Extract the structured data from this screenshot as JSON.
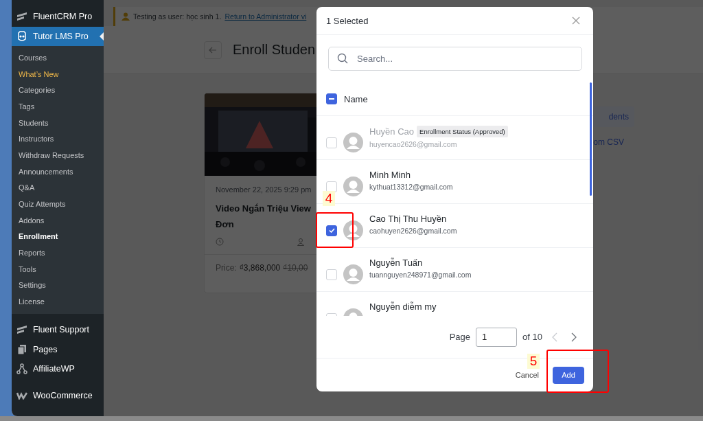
{
  "sidebar": {
    "items": [
      {
        "label": "FluentCRM Pro",
        "selected": false
      },
      {
        "label": "Tutor LMS Pro",
        "selected": true,
        "children": [
          {
            "label": "Courses",
            "selected": false,
            "accent": false
          },
          {
            "label": "What’s New",
            "selected": false,
            "accent": true
          },
          {
            "label": "Categories",
            "selected": false,
            "accent": false
          },
          {
            "label": "Tags",
            "selected": false,
            "accent": false
          },
          {
            "label": "Students",
            "selected": false,
            "accent": false
          },
          {
            "label": "Instructors",
            "selected": false,
            "accent": false
          },
          {
            "label": "Withdraw Requests",
            "selected": false,
            "accent": false
          },
          {
            "label": "Announcements",
            "selected": false,
            "accent": false
          },
          {
            "label": "Q&A",
            "selected": false,
            "accent": false
          },
          {
            "label": "Quiz Attempts",
            "selected": false,
            "accent": false
          },
          {
            "label": "Addons",
            "selected": false,
            "accent": false
          },
          {
            "label": "Enrollment",
            "selected": true,
            "accent": false
          },
          {
            "label": "Reports",
            "selected": false,
            "accent": false
          },
          {
            "label": "Tools",
            "selected": false,
            "accent": false
          },
          {
            "label": "Settings",
            "selected": false,
            "accent": false
          },
          {
            "label": "License",
            "selected": false,
            "accent": false
          }
        ]
      },
      {
        "label": "Fluent Support",
        "selected": false
      },
      {
        "label": "Pages",
        "selected": false
      },
      {
        "label": "AffiliateWP",
        "selected": false
      },
      {
        "label": "WooCommerce",
        "selected": false
      }
    ]
  },
  "notice": {
    "text": "Testing as user: học sinh 1.",
    "link": "Return to Administrator vi"
  },
  "page_title": "Enroll Studen",
  "course_card": {
    "date": "November 22, 2025 9:29 pm",
    "title_lines": [
      "Video Ngắn Triệu View",
      "Đơn"
    ],
    "price_label": "Price:",
    "price": "₫3,868,000",
    "old_price": "₫10,00"
  },
  "actions": {
    "button": "dents",
    "link": "om CSV"
  },
  "modal": {
    "title": "1 Selected",
    "search": {
      "placeholder": "Search..."
    },
    "header": {
      "label": "Name",
      "indeterminate": true
    },
    "rows": [
      {
        "name": "Huyền Cao",
        "email": "huyencao2626@gmail.com",
        "checked": false,
        "disabled": true,
        "badge": "Enrollment Status (Approved)"
      },
      {
        "name": "Minh Minh",
        "email": "kythuat13312@gmail.com",
        "checked": false,
        "disabled": false
      },
      {
        "name": "Cao Thị Thu Huyền",
        "email": "caohuyen2626@gmail.com",
        "checked": true,
        "disabled": false
      },
      {
        "name": "Nguyễn Tuấn",
        "email": "tuannguyen248971@gmail.com",
        "checked": false,
        "disabled": false
      },
      {
        "name": "Nguyễn diễm my",
        "checked": false,
        "disabled": false
      }
    ],
    "pagination": {
      "label": "Page",
      "value": "1",
      "total": "of 10"
    },
    "cancel": "Cancel",
    "add": "Add"
  },
  "annotations": [
    {
      "label": "4"
    },
    {
      "label": "5"
    }
  ]
}
